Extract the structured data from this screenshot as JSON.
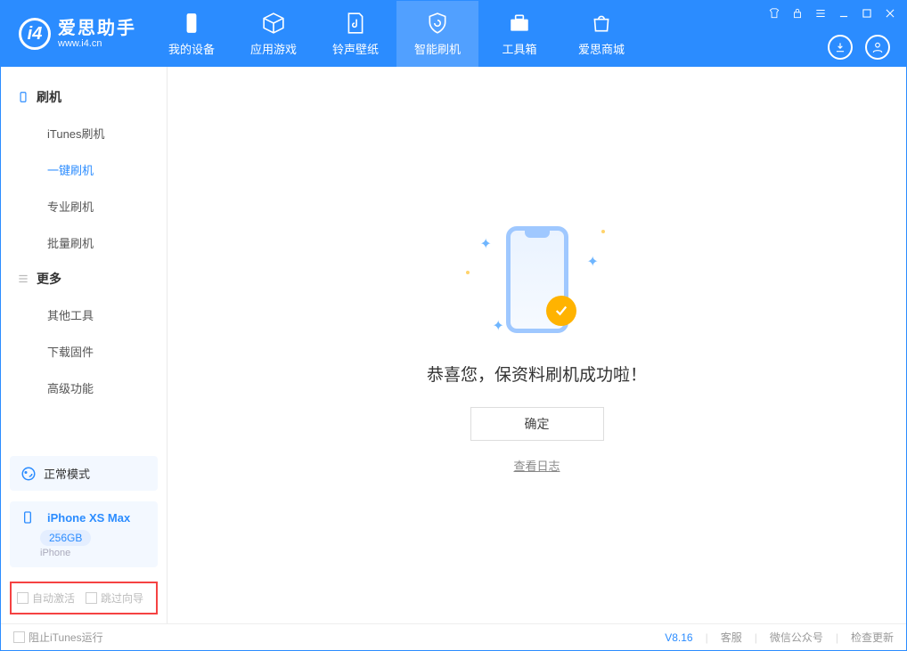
{
  "app": {
    "name": "爱思助手",
    "url": "www.i4.cn"
  },
  "tabs": {
    "device": "我的设备",
    "apps": "应用游戏",
    "ring": "铃声壁纸",
    "flash": "智能刷机",
    "tools": "工具箱",
    "store": "爱思商城"
  },
  "sidebar": {
    "group_flash": "刷机",
    "items_flash": [
      "iTunes刷机",
      "一键刷机",
      "专业刷机",
      "批量刷机"
    ],
    "group_more": "更多",
    "items_more": [
      "其他工具",
      "下载固件",
      "高级功能"
    ]
  },
  "mode": {
    "label": "正常模式"
  },
  "device": {
    "name": "iPhone XS Max",
    "storage": "256GB",
    "type": "iPhone"
  },
  "opts": {
    "auto_activate": "自动激活",
    "skip_guide": "跳过向导"
  },
  "main": {
    "message": "恭喜您，保资料刷机成功啦！",
    "ok": "确定",
    "view_log": "查看日志"
  },
  "footer": {
    "block_itunes": "阻止iTunes运行",
    "version": "V8.16",
    "support": "客服",
    "wechat": "微信公众号",
    "update": "检查更新"
  }
}
